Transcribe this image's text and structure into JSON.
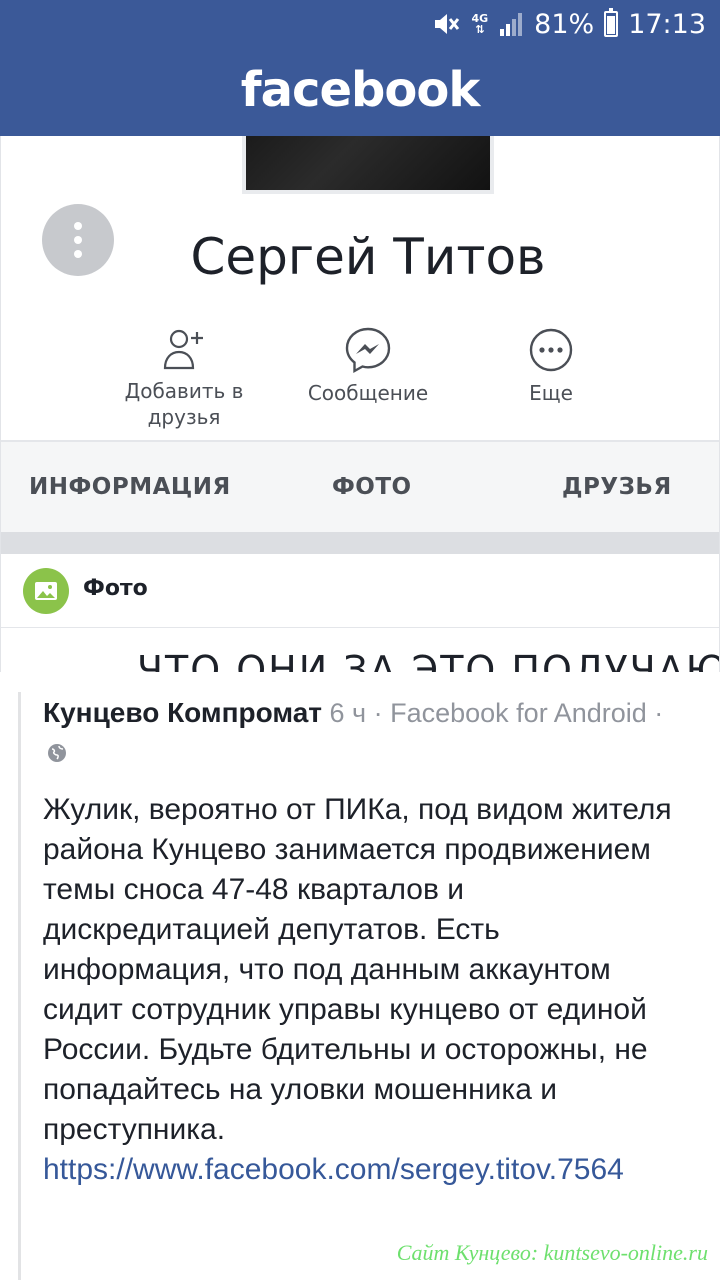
{
  "status_bar": {
    "network": "4G",
    "battery": "81%",
    "battery_level": 0.81,
    "time": "17:13"
  },
  "app_bar": {
    "brand": "facebook"
  },
  "profile": {
    "name": "Сергей Титов",
    "actions": [
      {
        "label": "Добавить в друзья",
        "icon": "add-friend-icon"
      },
      {
        "label": "Сообщение",
        "icon": "messenger-icon"
      },
      {
        "label": "Еще",
        "icon": "more-icon"
      }
    ],
    "tabs": [
      "ИНФОРМАЦИЯ",
      "ФОТО",
      "ДРУЗЬЯ"
    ],
    "section": {
      "label": "Фото",
      "icon": "photo-icon"
    },
    "partial_text": "ЧТО ОНИ ЗА ЭТО ПОЛУЧАЮТ"
  },
  "post": {
    "author": "Кунцево Компромат",
    "meta": "6 ч · Facebook for Android ·",
    "body": "Жулик, вероятно от ПИКа, под видом жителя района Кунцево занимается продвижением темы сноса 47-48 кварталов и дискредитацией депутатов. Есть информация, что под данным аккаунтом сидит сотрудник управы кунцево от единой России. Будьте бдительны и осторожны, не попадайтесь на уловки мошенника и преступника.",
    "link": "https://www.facebook.com/sergey.titov.7564"
  },
  "watermark": "Сайт Кунцево:  kuntsevo-online.ru",
  "colors": {
    "brand_blue": "#3b5998",
    "link_blue": "#365899",
    "photo_green": "#8bc34a",
    "watermark_green": "#6ee06e"
  }
}
